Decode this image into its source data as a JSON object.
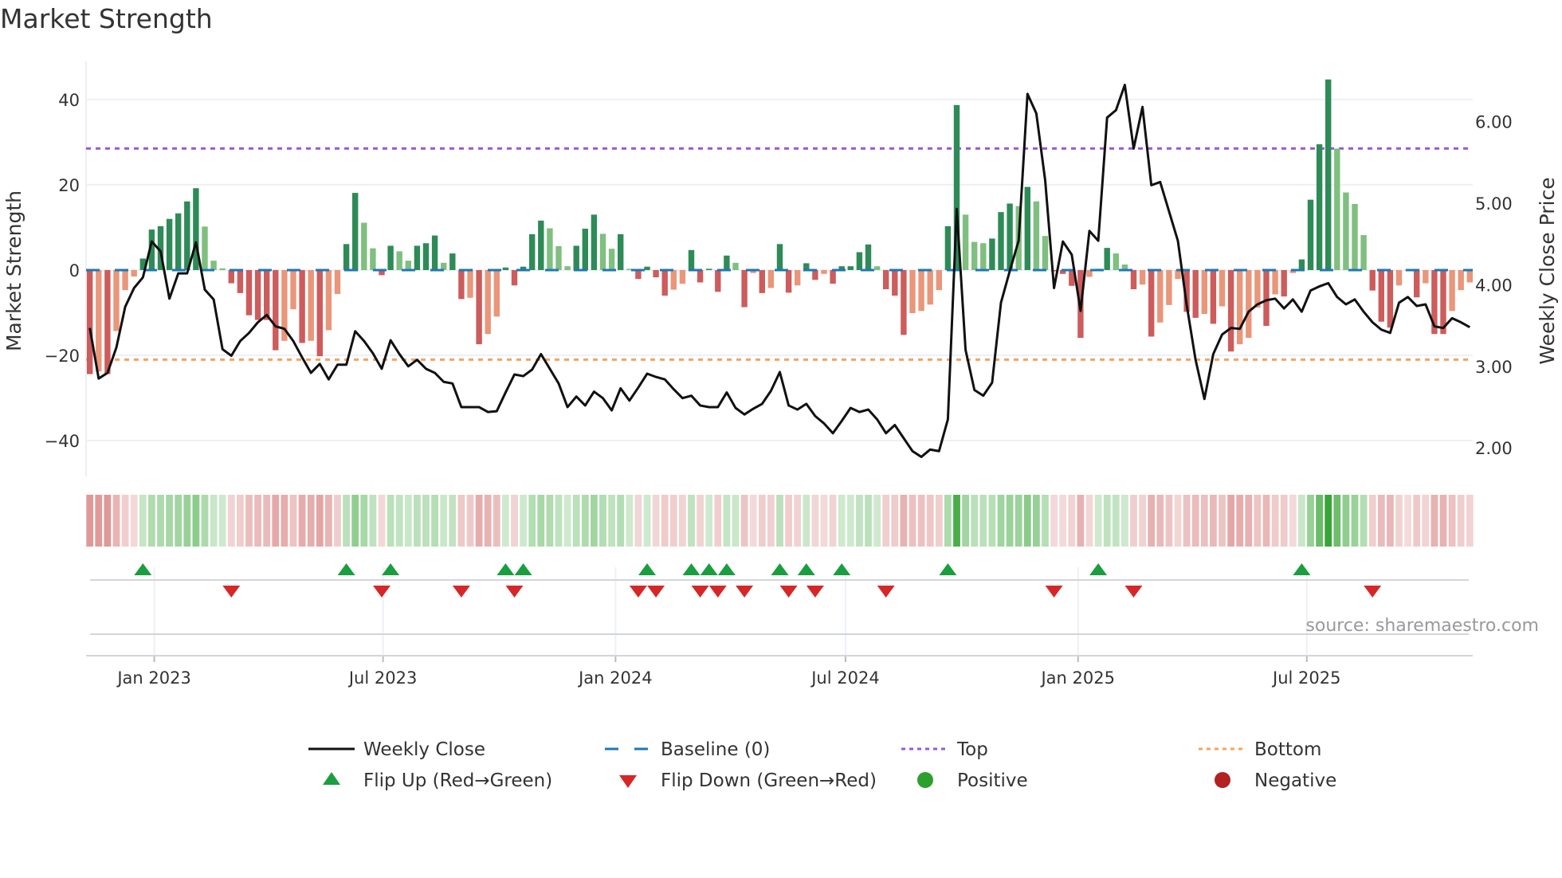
{
  "title": "Market Strength",
  "source": "source: sharemaestro.com",
  "legend": {
    "weekly_close": "Weekly Close",
    "baseline": "Baseline (0)",
    "top": "Top",
    "bottom": "Bottom",
    "flip_up": "Flip Up (Red→Green)",
    "flip_down": "Flip Down (Green→Red)",
    "positive": "Positive",
    "negative": "Negative"
  },
  "colors": {
    "pos_strong": "#2e8b57",
    "pos_weak": "#7fbf7f",
    "neg_strong": "#cd5c5c",
    "neg_weak": "#e9967a",
    "close": "#111111",
    "baseline": "#1f77b4",
    "top": "#9b59d6",
    "bottom": "#f4a460",
    "flip_up": "#1a9e3f",
    "flip_down": "#d62728",
    "positive": "#2ca02c",
    "negative": "#b22222"
  },
  "chart_data": {
    "type": "bar+line",
    "start_date": "2022-11-11",
    "frequency": "weekly",
    "ylabel_left": "Market Strength",
    "ylabel_right": "Weekly Close Price",
    "ylim_left": [
      -48.4,
      48.2
    ],
    "ylim_right": [
      1.65,
      6.7
    ],
    "yticks_left": [
      {
        "v": 40,
        "label": "40"
      },
      {
        "v": 20,
        "label": "20"
      },
      {
        "v": 0,
        "label": "0"
      },
      {
        "v": -20,
        "label": "−20"
      },
      {
        "v": -40,
        "label": "−40"
      }
    ],
    "yticks_right": [
      {
        "v": 6,
        "label": "6.00"
      },
      {
        "v": 5,
        "label": "5.00"
      },
      {
        "v": 4,
        "label": "4.00"
      },
      {
        "v": 3,
        "label": "3.00"
      },
      {
        "v": 2,
        "label": "2.00"
      }
    ],
    "xticks": [
      {
        "date": "2023-01-01",
        "label": "Jan 2023"
      },
      {
        "date": "2023-07-01",
        "label": "Jul 2023"
      },
      {
        "date": "2024-01-01",
        "label": "Jan 2024"
      },
      {
        "date": "2024-07-01",
        "label": "Jul 2024"
      },
      {
        "date": "2025-01-01",
        "label": "Jan 2025"
      },
      {
        "date": "2025-07-01",
        "label": "Jul 2025"
      }
    ],
    "baseline": 0,
    "top": 28.5,
    "bottom": -21,
    "strength": [
      -24.4,
      -23.8,
      -24.4,
      -14.3,
      -4.7,
      -1.5,
      2.7,
      9.5,
      10.3,
      12,
      13.3,
      16.1,
      19.2,
      10.2,
      2.2,
      0.4,
      -3.1,
      -5.4,
      -10.6,
      -11.7,
      -11.7,
      -18.8,
      -16.6,
      -9.2,
      -17.1,
      -16.6,
      -20.2,
      -14.1,
      -5.6,
      6.1,
      18.1,
      11.1,
      5.1,
      -1.2,
      5.7,
      4.4,
      2.2,
      5.7,
      6.3,
      8.1,
      1.7,
      3.9,
      -6.8,
      -6.5,
      -17.4,
      -15,
      -10.9,
      0.6,
      -3.6,
      0.8,
      8.4,
      11.6,
      9.8,
      5.6,
      0.9,
      5.7,
      9.7,
      13,
      8.5,
      5,
      8.4,
      0.3,
      -2.1,
      0.8,
      -1.7,
      -6,
      -4.6,
      -3.2,
      4.7,
      -2.9,
      0.3,
      -5.1,
      3.4,
      1.7,
      -8.7,
      -0.7,
      -5.4,
      -4.2,
      6.1,
      -5.3,
      -3.6,
      1.6,
      -2.3,
      -0.9,
      -3.2,
      0.9,
      0.9,
      4.2,
      6,
      0.9,
      -4.5,
      -6,
      -15.2,
      -10.1,
      -9.6,
      -8.1,
      -4.7,
      10.3,
      38.7,
      13,
      6.6,
      6.3,
      7.4,
      13.6,
      15.6,
      15,
      19.5,
      16.1,
      8,
      -0.3,
      -0.9,
      -3.7,
      -15.9,
      -1.6,
      0.3,
      5.2,
      3.9,
      1.3,
      -4.5,
      -3.4,
      -15.6,
      -12.3,
      -8.2,
      -2.1,
      -9.8,
      -11.2,
      -10.3,
      -12.6,
      -8.5,
      -19.1,
      -17.4,
      -15.9,
      -8.8,
      -13.1,
      -5.7,
      -6.2,
      -0.7,
      2.5,
      16.5,
      29.5,
      44.7,
      28.5,
      18.2,
      15.5,
      8.2,
      -4.8,
      -12.1,
      -13.5,
      -3.6,
      -0.2,
      -6.4,
      -3.1,
      -15,
      -15,
      -9.6,
      -4.7,
      -2.9
    ],
    "close": [
      3.47,
      2.85,
      2.92,
      3.23,
      3.73,
      3.96,
      4.09,
      4.53,
      4.41,
      3.83,
      4.14,
      4.14,
      4.52,
      3.94,
      3.82,
      3.21,
      3.13,
      3.31,
      3.41,
      3.54,
      3.63,
      3.49,
      3.46,
      3.31,
      3.11,
      2.92,
      3.03,
      2.84,
      3.02,
      3.02,
      3.43,
      3.31,
      3.16,
      2.97,
      3.32,
      3.15,
      3.0,
      3.08,
      2.97,
      2.92,
      2.81,
      2.79,
      2.5,
      2.5,
      2.5,
      2.44,
      2.45,
      2.68,
      2.9,
      2.88,
      2.96,
      3.15,
      2.97,
      2.79,
      2.5,
      2.63,
      2.52,
      2.69,
      2.61,
      2.46,
      2.73,
      2.58,
      2.74,
      2.91,
      2.87,
      2.84,
      2.72,
      2.61,
      2.64,
      2.52,
      2.5,
      2.5,
      2.68,
      2.49,
      2.41,
      2.48,
      2.54,
      2.7,
      2.93,
      2.52,
      2.47,
      2.54,
      2.39,
      2.3,
      2.18,
      2.33,
      2.49,
      2.44,
      2.47,
      2.35,
      2.18,
      2.28,
      2.12,
      1.96,
      1.89,
      1.98,
      1.96,
      2.35,
      4.93,
      3.2,
      2.71,
      2.64,
      2.8,
      3.78,
      4.17,
      4.54,
      6.34,
      6.1,
      5.28,
      3.96,
      4.53,
      4.37,
      3.68,
      4.66,
      4.54,
      6.05,
      6.14,
      6.45,
      5.67,
      6.18,
      5.22,
      5.26,
      4.9,
      4.54,
      3.75,
      3.08,
      2.6,
      3.15,
      3.39,
      3.47,
      3.46,
      3.67,
      3.76,
      3.81,
      3.83,
      3.71,
      3.82,
      3.67,
      3.93,
      3.98,
      4.02,
      3.85,
      3.76,
      3.82,
      3.67,
      3.54,
      3.45,
      3.41,
      3.78,
      3.85,
      3.74,
      3.76,
      3.49,
      3.47,
      3.59,
      3.54,
      3.48
    ],
    "legend_position": "bottom"
  }
}
